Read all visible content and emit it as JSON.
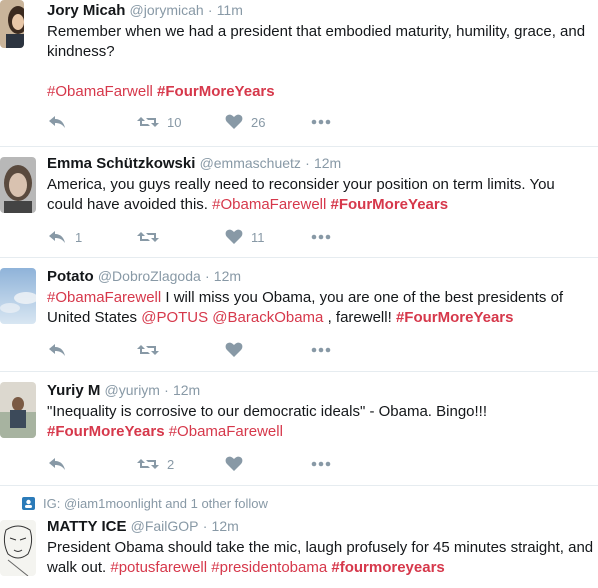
{
  "tweets": [
    {
      "name": "Jory Micah",
      "handle": "@jorymicah",
      "dot": "·",
      "time": "11m",
      "text_plain": "Remember when we had a president that embodied maturity, humility, grace, and kindness?",
      "tag1": "#ObamaFarwell",
      "tag2": "#FourMoreYears",
      "reply_count": "",
      "retweet_count": "10",
      "like_count": "26"
    },
    {
      "name": "Emma Schützkowski",
      "handle": "@emmaschuetz",
      "dot": "·",
      "time": "12m",
      "text_plain": "America, you guys really need to reconsider your position on term limits. You could have avoided this.",
      "tag1": "#ObamaFarewell",
      "tag2": "#FourMoreYears",
      "reply_count": "1",
      "retweet_count": "",
      "like_count": "11"
    },
    {
      "name": "Potato",
      "handle": "@DobroZlagoda",
      "dot": "·",
      "time": "12m",
      "tag1": "#ObamaFarewell",
      "text_a": " I will miss you Obama, you are one of the best presidents of United States ",
      "mention1": "@POTUS",
      "mention2": "@BarackObama",
      "text_b": " , farewell! ",
      "tag2": "#FourMoreYears",
      "reply_count": "",
      "retweet_count": "",
      "like_count": ""
    },
    {
      "name": "Yuriy M",
      "handle": "@yuriym",
      "dot": "·",
      "time": "12m",
      "text_plain": "\"Inequality is corrosive to our democratic ideals\" - Obama. Bingo!!!",
      "tag1": "#FourMoreYears",
      "tag2": "#ObamaFarewell",
      "reply_count": "",
      "retweet_count": "2",
      "like_count": ""
    },
    {
      "context": "IG: @iam1moonlight and 1 other follow",
      "name": "MATTY ICE",
      "handle": "@FailGOP",
      "dot": "·",
      "time": "12m",
      "text_plain": "President Obama should take the mic, laugh profusely for 45 minutes straight, and walk out.",
      "tag1": "#potusfarewell",
      "tag2": "#presidentobama",
      "tag3": "#fourmoreyears"
    }
  ],
  "colors": {
    "accent": "#d6384b",
    "muted": "#8899a6",
    "text": "#14171a",
    "divider": "#e6ecf0"
  },
  "icons": {
    "reply": "reply-icon",
    "retweet": "retweet-icon",
    "like": "heart-icon",
    "more": "more-dots-icon"
  }
}
